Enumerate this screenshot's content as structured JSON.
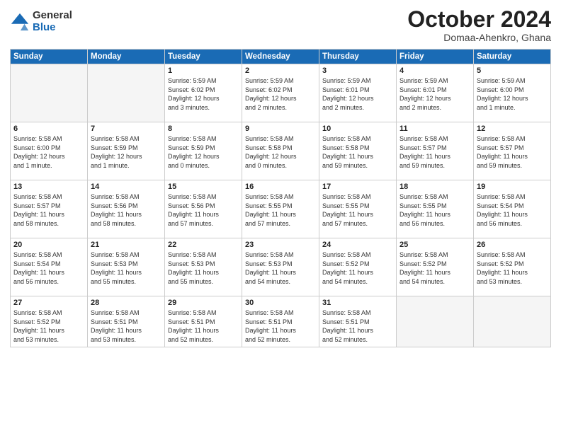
{
  "header": {
    "logo_general": "General",
    "logo_blue": "Blue",
    "month": "October 2024",
    "location": "Domaa-Ahenkro, Ghana"
  },
  "weekdays": [
    "Sunday",
    "Monday",
    "Tuesday",
    "Wednesday",
    "Thursday",
    "Friday",
    "Saturday"
  ],
  "weeks": [
    [
      {
        "day": "",
        "info": ""
      },
      {
        "day": "",
        "info": ""
      },
      {
        "day": "1",
        "info": "Sunrise: 5:59 AM\nSunset: 6:02 PM\nDaylight: 12 hours\nand 3 minutes."
      },
      {
        "day": "2",
        "info": "Sunrise: 5:59 AM\nSunset: 6:02 PM\nDaylight: 12 hours\nand 2 minutes."
      },
      {
        "day": "3",
        "info": "Sunrise: 5:59 AM\nSunset: 6:01 PM\nDaylight: 12 hours\nand 2 minutes."
      },
      {
        "day": "4",
        "info": "Sunrise: 5:59 AM\nSunset: 6:01 PM\nDaylight: 12 hours\nand 2 minutes."
      },
      {
        "day": "5",
        "info": "Sunrise: 5:59 AM\nSunset: 6:00 PM\nDaylight: 12 hours\nand 1 minute."
      }
    ],
    [
      {
        "day": "6",
        "info": "Sunrise: 5:58 AM\nSunset: 6:00 PM\nDaylight: 12 hours\nand 1 minute."
      },
      {
        "day": "7",
        "info": "Sunrise: 5:58 AM\nSunset: 5:59 PM\nDaylight: 12 hours\nand 1 minute."
      },
      {
        "day": "8",
        "info": "Sunrise: 5:58 AM\nSunset: 5:59 PM\nDaylight: 12 hours\nand 0 minutes."
      },
      {
        "day": "9",
        "info": "Sunrise: 5:58 AM\nSunset: 5:58 PM\nDaylight: 12 hours\nand 0 minutes."
      },
      {
        "day": "10",
        "info": "Sunrise: 5:58 AM\nSunset: 5:58 PM\nDaylight: 11 hours\nand 59 minutes."
      },
      {
        "day": "11",
        "info": "Sunrise: 5:58 AM\nSunset: 5:57 PM\nDaylight: 11 hours\nand 59 minutes."
      },
      {
        "day": "12",
        "info": "Sunrise: 5:58 AM\nSunset: 5:57 PM\nDaylight: 11 hours\nand 59 minutes."
      }
    ],
    [
      {
        "day": "13",
        "info": "Sunrise: 5:58 AM\nSunset: 5:57 PM\nDaylight: 11 hours\nand 58 minutes."
      },
      {
        "day": "14",
        "info": "Sunrise: 5:58 AM\nSunset: 5:56 PM\nDaylight: 11 hours\nand 58 minutes."
      },
      {
        "day": "15",
        "info": "Sunrise: 5:58 AM\nSunset: 5:56 PM\nDaylight: 11 hours\nand 57 minutes."
      },
      {
        "day": "16",
        "info": "Sunrise: 5:58 AM\nSunset: 5:55 PM\nDaylight: 11 hours\nand 57 minutes."
      },
      {
        "day": "17",
        "info": "Sunrise: 5:58 AM\nSunset: 5:55 PM\nDaylight: 11 hours\nand 57 minutes."
      },
      {
        "day": "18",
        "info": "Sunrise: 5:58 AM\nSunset: 5:55 PM\nDaylight: 11 hours\nand 56 minutes."
      },
      {
        "day": "19",
        "info": "Sunrise: 5:58 AM\nSunset: 5:54 PM\nDaylight: 11 hours\nand 56 minutes."
      }
    ],
    [
      {
        "day": "20",
        "info": "Sunrise: 5:58 AM\nSunset: 5:54 PM\nDaylight: 11 hours\nand 56 minutes."
      },
      {
        "day": "21",
        "info": "Sunrise: 5:58 AM\nSunset: 5:53 PM\nDaylight: 11 hours\nand 55 minutes."
      },
      {
        "day": "22",
        "info": "Sunrise: 5:58 AM\nSunset: 5:53 PM\nDaylight: 11 hours\nand 55 minutes."
      },
      {
        "day": "23",
        "info": "Sunrise: 5:58 AM\nSunset: 5:53 PM\nDaylight: 11 hours\nand 54 minutes."
      },
      {
        "day": "24",
        "info": "Sunrise: 5:58 AM\nSunset: 5:52 PM\nDaylight: 11 hours\nand 54 minutes."
      },
      {
        "day": "25",
        "info": "Sunrise: 5:58 AM\nSunset: 5:52 PM\nDaylight: 11 hours\nand 54 minutes."
      },
      {
        "day": "26",
        "info": "Sunrise: 5:58 AM\nSunset: 5:52 PM\nDaylight: 11 hours\nand 53 minutes."
      }
    ],
    [
      {
        "day": "27",
        "info": "Sunrise: 5:58 AM\nSunset: 5:52 PM\nDaylight: 11 hours\nand 53 minutes."
      },
      {
        "day": "28",
        "info": "Sunrise: 5:58 AM\nSunset: 5:51 PM\nDaylight: 11 hours\nand 53 minutes."
      },
      {
        "day": "29",
        "info": "Sunrise: 5:58 AM\nSunset: 5:51 PM\nDaylight: 11 hours\nand 52 minutes."
      },
      {
        "day": "30",
        "info": "Sunrise: 5:58 AM\nSunset: 5:51 PM\nDaylight: 11 hours\nand 52 minutes."
      },
      {
        "day": "31",
        "info": "Sunrise: 5:58 AM\nSunset: 5:51 PM\nDaylight: 11 hours\nand 52 minutes."
      },
      {
        "day": "",
        "info": ""
      },
      {
        "day": "",
        "info": ""
      }
    ]
  ]
}
